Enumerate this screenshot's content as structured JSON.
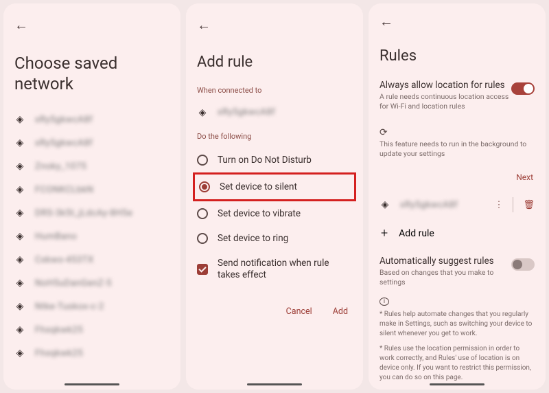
{
  "left": {
    "title": "Choose saved network",
    "networks": [
      "xRy5gkwcA8f",
      "xRy5gkwcA8f",
      "Znoky_1075",
      "FCONKCLbkN",
      "DRS-3k5t_jLdcAy-8H5e",
      "HumBano",
      "Cxkwo-453TX",
      "NoH5uDanGenZ-5",
      "Ntke-Tuskox-c-2",
      "Fhxqkwk25",
      "Fhxqkwk25"
    ]
  },
  "mid": {
    "title": "Add rule",
    "when_label": "When connected to",
    "connected_network": "xRy5gkwcA8f",
    "do_label": "Do the following",
    "options": {
      "dnd": "Turn on Do Not Disturb",
      "silent": "Set device to silent",
      "vibrate": "Set device to vibrate",
      "ring": "Set device to ring",
      "notify": "Send notification when rule takes effect"
    },
    "cancel": "Cancel",
    "add": "Add"
  },
  "right": {
    "title": "Rules",
    "loc_title": "Always allow location for rules",
    "loc_desc": "A rule needs continuous location access for Wi-Fi and location rules",
    "bg_desc": "This feature needs to run in the background to update your settings",
    "next": "Next",
    "rule_network": "xRy5gkwcA8f",
    "add_rule": "Add rule",
    "auto_title": "Automatically suggest rules",
    "auto_desc": "Based on changes that you make to settings",
    "foot1": "* Rules help automate changes that you regularly make in Settings, such as switching your device to silent whenever you get to work.",
    "foot2": "* Rules use the location permission in order to work correctly, and Rules' use of location is on device only. If you want to restrict this permission, you can do so on this page."
  }
}
